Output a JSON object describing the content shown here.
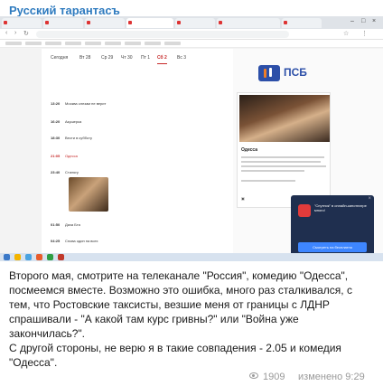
{
  "channel": {
    "title": "Русский тарантасъ"
  },
  "screenshot": {
    "sidebar": {
      "brand": "ПСБ"
    },
    "card": {
      "title": "Одесса"
    },
    "popup": {
      "text": "\"Спутник\" в онлайн-кинотеатре много!",
      "button": "Смотреть на бесплатно"
    },
    "schedule": {
      "days": [
        "Сегодня",
        "Вт 28",
        "Ср 29",
        "Чт 30",
        "Пт 1",
        "Сб 2",
        "Вс 3"
      ],
      "selected_day": "Сб 2",
      "rows": [
        {
          "time": "13:20",
          "title": "Москва слезам не верит"
        },
        {
          "time": "16:20",
          "title": "Акушерка"
        },
        {
          "time": "18:30",
          "title": "Вести в субботу"
        },
        {
          "time": "21:05",
          "title": "Одесса"
        },
        {
          "time": "23:40",
          "title": "Стилягу"
        },
        {
          "time": "01:50",
          "title": "Дача Бта"
        },
        {
          "time": "04:25",
          "title": "Снова один на всех"
        }
      ]
    }
  },
  "message": {
    "paragraph1": "Второго мая, смотрите на телеканале \"Россия\", комедию \"Одесса\", посмеемся вместе. Возможно это ошибка, много раз сталкивался, с тем, что Ростовские таксисты, везшие меня от границы с ЛДНР спрашивали - \"А какой там курс гривны?\" или \"Война уже закончилась?\".",
    "paragraph2": " С другой стороны, не верю я в такие совпадения - 2.05 и комедия \"Одесса\"."
  },
  "footer": {
    "views": "1909",
    "edited": "изменено 9:29"
  },
  "colors": {
    "accent": "#2f7bbf",
    "brand": "#2c4fa8",
    "highlight": "#c62828"
  }
}
